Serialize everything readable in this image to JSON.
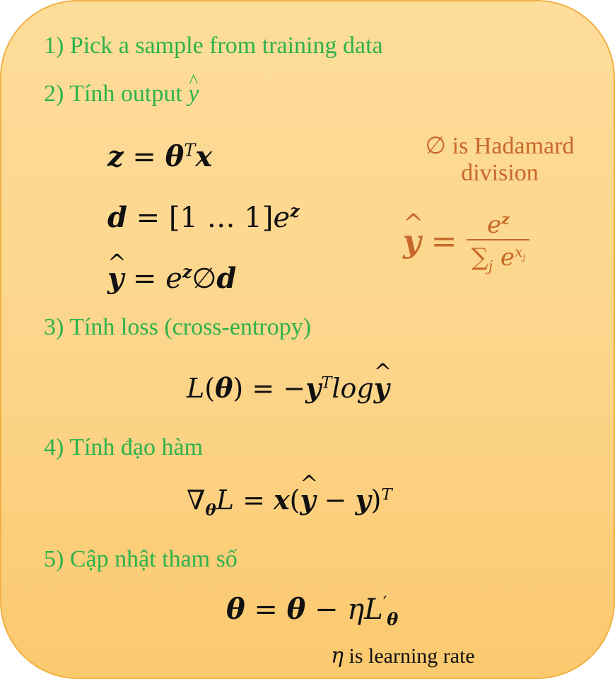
{
  "steps": {
    "s1": "1) Pick a sample from training data",
    "s2": "2) Tính output",
    "s3": "3) Tính loss (cross-entropy)",
    "s4": "4) Tính đạo hàm",
    "s5": "5) Cập nhật tham số"
  },
  "notes": {
    "hadamard_line1": "∅ is Hadamard",
    "hadamard_line2": "division",
    "learning_rate": "is learning rate"
  },
  "colors": {
    "step_text": "#2DB24B",
    "note_text": "#C8682A",
    "card_fill": "#FDD690",
    "card_border": "#F2B042",
    "equation_text": "#111111"
  }
}
